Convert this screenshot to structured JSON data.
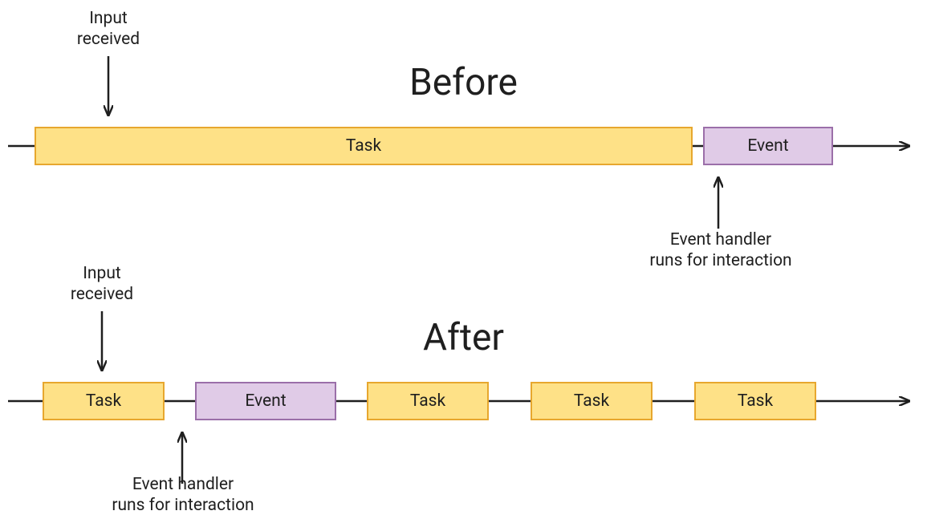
{
  "titles": {
    "before": "Before",
    "after": "After"
  },
  "annotations": {
    "input_received": "Input\nreceived",
    "event_handler": "Event handler\nruns for interaction"
  },
  "labels": {
    "task": "Task",
    "event": "Event"
  },
  "colors": {
    "task_fill": "#fee187",
    "task_border": "#e7a72e",
    "event_fill": "#e0cbe7",
    "event_border": "#9b6fa9",
    "line": "#1f1f1f"
  },
  "chart_data": [
    {
      "type": "timeline",
      "title": "Before",
      "segments": [
        {
          "kind": "task",
          "label": "Task",
          "length_units": 10
        },
        {
          "kind": "event",
          "label": "Event",
          "length_units": 2
        }
      ],
      "annotations": [
        {
          "text": "Input received",
          "attached_to": 0,
          "position": "above"
        },
        {
          "text": "Event handler runs for interaction",
          "attached_to": 1,
          "position": "below"
        }
      ]
    },
    {
      "type": "timeline",
      "title": "After",
      "segments": [
        {
          "kind": "task",
          "label": "Task",
          "length_units": 2
        },
        {
          "kind": "event",
          "label": "Event",
          "length_units": 2
        },
        {
          "kind": "task",
          "label": "Task",
          "length_units": 2
        },
        {
          "kind": "task",
          "label": "Task",
          "length_units": 2
        },
        {
          "kind": "task",
          "label": "Task",
          "length_units": 2
        }
      ],
      "annotations": [
        {
          "text": "Input received",
          "attached_to": 0,
          "position": "above"
        },
        {
          "text": "Event handler runs for interaction",
          "attached_to": 1,
          "position": "below"
        }
      ]
    }
  ]
}
